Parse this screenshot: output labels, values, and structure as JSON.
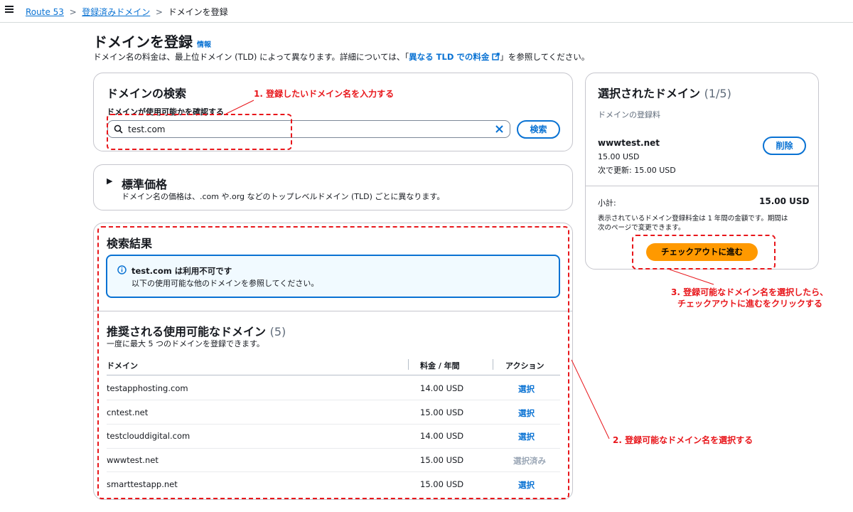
{
  "breadcrumb": {
    "items": [
      "Route 53",
      "登録済みドメイン"
    ],
    "current": "ドメインを登録"
  },
  "header": {
    "title": "ドメインを登録",
    "info": "情報",
    "desc_prefix": "ドメイン名の料金は、最上位ドメイン (TLD) によって異なります。詳細については、「",
    "desc_link": "異なる TLD での料金",
    "desc_suffix": "」を参照してください。"
  },
  "search": {
    "title": "ドメインの検索",
    "label": "ドメインが使用可能かを確認する",
    "value": "test.com",
    "button": "検索"
  },
  "pricing": {
    "title": "標準価格",
    "desc": "ドメイン名の価格は、.com や.org などのトップレベルドメイン (TLD) ごとに異なります。"
  },
  "results": {
    "title": "検索結果",
    "alert_title": "test.com は利用不可です",
    "alert_text": "以下の使用可能な他のドメインを参照してください。",
    "suggest_title": "推奨される使用可能なドメイン",
    "suggest_count": "(5)",
    "suggest_desc": "一度に最大 5 つのドメインを登録できます。",
    "columns": [
      "ドメイン",
      "料金 / 年間",
      "アクション"
    ],
    "rows": [
      {
        "domain": "testapphosting.com",
        "price": "14.00 USD",
        "action": "選択",
        "selected": false
      },
      {
        "domain": "cntest.net",
        "price": "15.00 USD",
        "action": "選択",
        "selected": false
      },
      {
        "domain": "testclouddigital.com",
        "price": "14.00 USD",
        "action": "選択",
        "selected": false
      },
      {
        "domain": "wwwtest.net",
        "price": "15.00 USD",
        "action": "選択済み",
        "selected": true
      },
      {
        "domain": "smarttestapp.net",
        "price": "15.00 USD",
        "action": "選択",
        "selected": false
      }
    ]
  },
  "selected": {
    "title": "選択されたドメイン",
    "count": "(1/5)",
    "fee_label": "ドメインの登録料",
    "domain": "wwwtest.net",
    "price": "15.00 USD",
    "renew": "次で更新: 15.00 USD",
    "remove": "削除",
    "subtotal_label": "小計:",
    "subtotal": "15.00 USD",
    "note1": "表示されているドメイン登録料金は 1 年間の金額です。期間は",
    "note2": "次のページで変更できます。",
    "checkout": "チェックアウトに進む"
  },
  "annotations": {
    "a1": "1. 登録したいドメイン名を入力する",
    "a2": "2. 登録可能なドメイン名を選択する",
    "a3_line1": "3. 登録可能なドメイン名を選択したら、",
    "a3_line2": "チェックアウトに進むをクリックする"
  },
  "colors": {
    "accent": "#0972d3",
    "annotation": "#e8161b",
    "checkout": "#ff9900"
  }
}
